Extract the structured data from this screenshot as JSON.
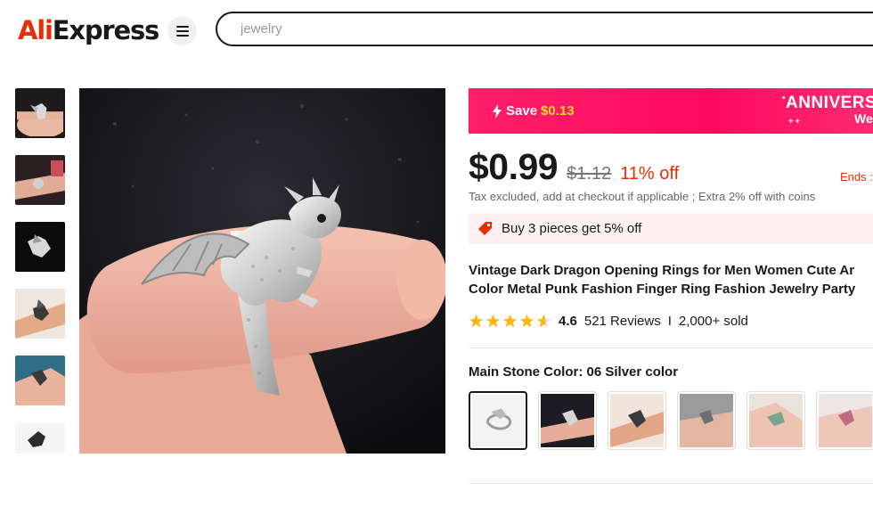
{
  "header": {
    "logo_part1": "Ali",
    "logo_part2": "Express",
    "search_placeholder": "jewelry"
  },
  "promo": {
    "save_label": "Save",
    "save_amount": "$0.13",
    "anniversary": "ANNIVERS",
    "anniversary_sub": "We"
  },
  "price": {
    "current": "$0.99",
    "original": "$1.12",
    "discount": "11% off",
    "ends": "Ends :",
    "tax_note": "Tax excluded, add at checkout if applicable ; Extra 2% off with coins"
  },
  "coupon": {
    "text": "Buy 3 pieces get 5% off"
  },
  "product": {
    "title_line1": "Vintage Dark Dragon Opening Rings for Men Women Cute Ar",
    "title_line2": "Color Metal Punk Fashion Finger Ring Fashion Jewelry Party"
  },
  "rating": {
    "score": "4.6",
    "reviews": "521 Reviews",
    "separator": "I",
    "sold": "2,000+ sold",
    "stars_value": 4.6
  },
  "variant": {
    "label": "Main Stone Color:",
    "selected": "06 Silver color"
  },
  "icons": {
    "menu": "hamburger-icon",
    "promo": "lightning-icon",
    "coupon": "tag-icon",
    "star": "star-icon"
  },
  "colors": {
    "brand_red": "#e62e04",
    "promo_pink": "#fd0a5e",
    "promo_yellow": "#ffde2b",
    "star_gold": "#fdb813",
    "coupon_bg": "#fff0f1"
  }
}
